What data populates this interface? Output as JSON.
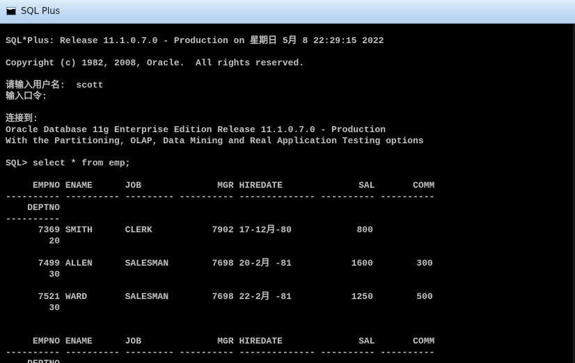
{
  "window": {
    "title": "SQL Plus"
  },
  "console": {
    "lines": [
      "",
      "SQL*Plus: Release 11.1.0.7.0 - Production on 星期日 5月 8 22:29:15 2022",
      "",
      "Copyright (c) 1982, 2008, Oracle.  All rights reserved.",
      "",
      "请输入用户名:  scott",
      "输入口令:",
      "",
      "连接到:",
      "Oracle Database 11g Enterprise Edition Release 11.1.0.7.0 - Production",
      "With the Partitioning, OLAP, Data Mining and Real Application Testing options",
      "",
      "SQL> select * from emp;",
      "",
      "     EMPNO ENAME      JOB              MGR HIREDATE              SAL       COMM",
      "---------- ---------- --------- ---------- -------------- ---------- ----------",
      "    DEPTNO",
      "----------",
      "      7369 SMITH      CLERK           7902 17-12月-80            800",
      "        20",
      "",
      "      7499 ALLEN      SALESMAN        7698 20-2月 -81           1600        300",
      "        30",
      "",
      "      7521 WARD       SALESMAN        7698 22-2月 -81           1250        500",
      "        30",
      "",
      "",
      "     EMPNO ENAME      JOB              MGR HIREDATE              SAL       COMM",
      "---------- ---------- --------- ---------- -------------- ---------- ----------",
      "    DEPTNO"
    ]
  }
}
